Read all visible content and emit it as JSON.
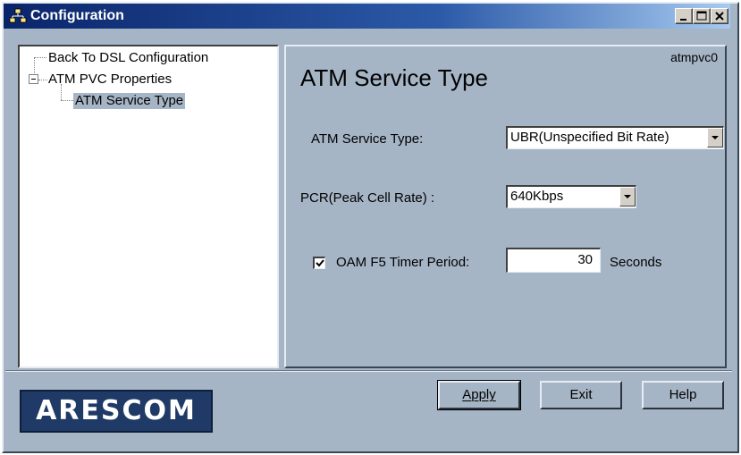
{
  "window": {
    "title": "Configuration",
    "icon": "network-icon",
    "controls": [
      "minimize-icon",
      "maximize-icon",
      "close-icon"
    ]
  },
  "tree": {
    "items": [
      {
        "label": "Back To DSL Configuration",
        "level": 0
      },
      {
        "label": "ATM PVC Properties",
        "level": 0,
        "expanded": true
      },
      {
        "label": "ATM Service Type",
        "level": 1,
        "selected": true
      }
    ]
  },
  "content": {
    "pvc_id": "atmpvc0",
    "heading": "ATM Service Type",
    "service_type": {
      "label": "ATM Service Type:",
      "value": "UBR(Unspecified Bit Rate)"
    },
    "pcr": {
      "label": "PCR(Peak Cell Rate) :",
      "value": "640Kbps"
    },
    "oam": {
      "checked": true,
      "label": "OAM F5 Timer Period:",
      "value": "30",
      "unit": "Seconds"
    }
  },
  "footer": {
    "logo_text": "ARESCOM",
    "buttons": {
      "apply": "Apply",
      "exit": "Exit",
      "help": "Help"
    }
  },
  "colors": {
    "panel_bg": "#a6b5c6",
    "titlebar_start": "#0a246a",
    "titlebar_end": "#a6caf0",
    "logo_bg": "#1f3a66"
  }
}
